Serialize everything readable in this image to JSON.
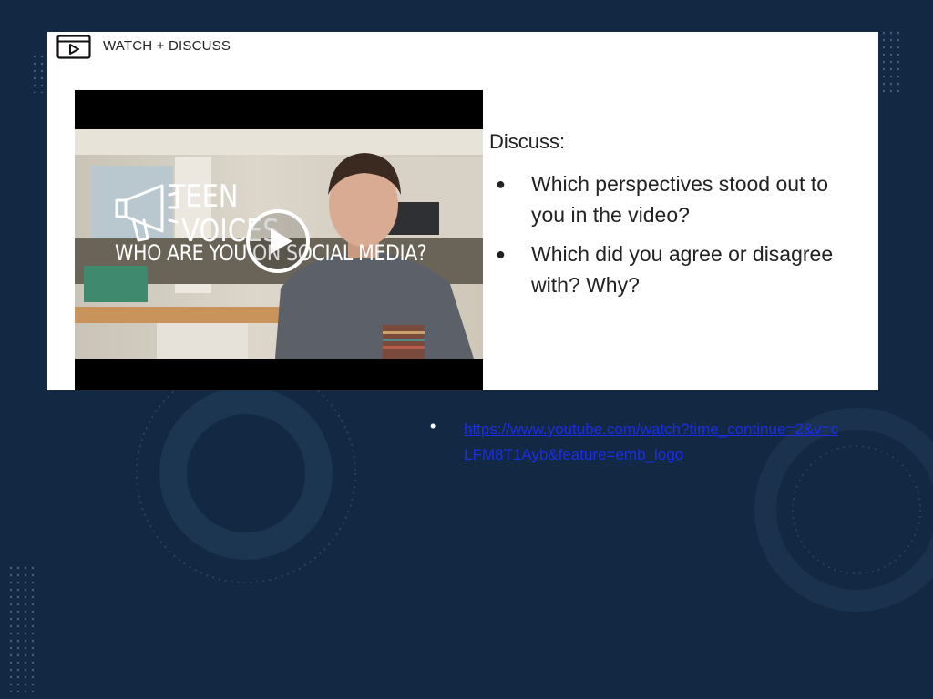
{
  "header": {
    "icon": "video-play-icon",
    "label": "WATCH + DISCUSS"
  },
  "video": {
    "thumbnail_title": "WHO ARE YOU ON SOCIAL MEDIA?",
    "logo": "teen-voices-logo",
    "logo_text": "TEEN VOICES",
    "play_icon": "play-icon"
  },
  "discussion": {
    "heading": "Discuss:",
    "questions": [
      {
        "bullet": "●",
        "text": "Which perspectives stood out to you in the video?"
      },
      {
        "bullet": "●",
        "text": "Which did you agree or disagree with? Why?"
      }
    ]
  },
  "link": {
    "bullet": "•",
    "url": "https://www.youtube.com/watch?time_continue=2&v=cLFM8T1Ayb&feature=emb_logo"
  },
  "colors": {
    "background": "#122843",
    "card": "#ffffff",
    "link": "#1c2ee6",
    "text": "#222222"
  }
}
